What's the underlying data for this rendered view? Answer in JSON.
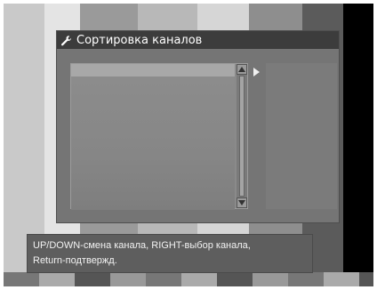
{
  "dialog": {
    "title": "Сортировка каналов",
    "icon": "wrench-icon"
  },
  "hint": {
    "line1": "UP/DOWN-смена канала, RIGHT-выбор канала,",
    "line2": "Return-подтвержд."
  },
  "colors": {
    "titlebar": "#3c3c3c",
    "dialog_bg": "#757575",
    "hint_bg": "#5e5e5e",
    "text": "#ffffff"
  }
}
